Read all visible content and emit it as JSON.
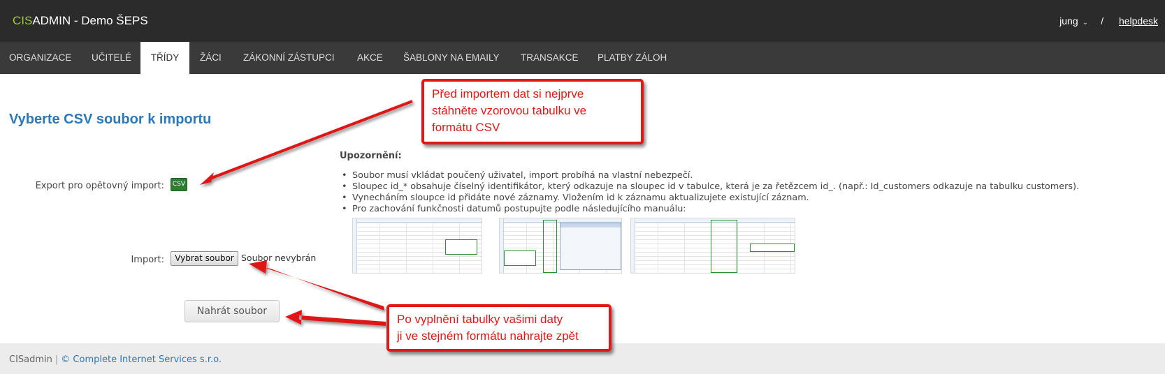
{
  "header": {
    "brand_prefix": "CIS",
    "brand_rest": "ADMIN - Demo ŠEPS",
    "user": "jung",
    "separator": "/",
    "helpdesk": "helpdesk"
  },
  "nav": {
    "items": [
      {
        "label": "ORGANIZACE"
      },
      {
        "label": "UČITELÉ"
      },
      {
        "label": "TŘÍDY"
      },
      {
        "label": "ŽÁCI"
      },
      {
        "label": "ZÁKONNÍ ZÁSTUPCI"
      },
      {
        "label": "AKCE"
      },
      {
        "label": "ŠABLONY NA EMAILY"
      },
      {
        "label": "TRANSAKCE"
      },
      {
        "label": "PLATBY ZÁLOH"
      }
    ],
    "active": "TŘÍDY"
  },
  "main": {
    "title": "Vyberte CSV soubor k importu",
    "export_label": "Export pro opětovný import:",
    "csv_icon_text": "CSV",
    "import_label": "Import:",
    "choose_file_button": "Vybrat soubor",
    "no_file_text": "Soubor nevybrán",
    "upload_button": "Nahrát soubor"
  },
  "notice": {
    "title": "Upozornění:",
    "items": [
      "Soubor musí vkládat poučený uživatel, import probíhá na vlastní nebezpečí.",
      "Sloupec id_* obsahuje číselný identifikátor, který odkazuje na sloupec id v tabulce, která je za řetězcem id_. (např.: Id_customers odkazuje na tabulku customers).",
      "Vynecháním sloupce id přidáte nové záznamy. Vložením id k záznamu aktualizujete existující záznam.",
      "Pro zachování funkčnosti datumů postupujte podle následujícího manuálu:"
    ]
  },
  "callouts": {
    "top": [
      "Před importem dat si nejprve",
      "stáhněte vzorovou tabulku ve",
      "formátu CSV"
    ],
    "bottom": [
      "Po vyplnění tabulky vašimi daty",
      "ji ve stejném formátu nahrajte zpět"
    ]
  },
  "footer": {
    "app": "CISadmin",
    "separator": "|",
    "company": "© Complete Internet Services s.r.o."
  },
  "colors": {
    "accent": "#2d78b7",
    "callout_red": "#e01818",
    "csv_green": "#2e7d32",
    "topbar": "#2b2b2b"
  }
}
